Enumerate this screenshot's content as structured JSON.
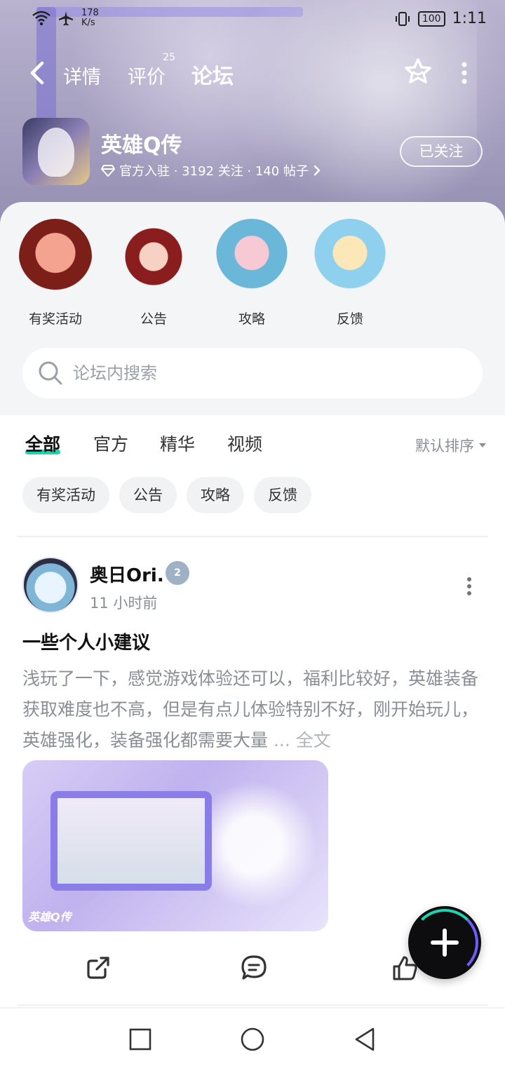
{
  "status": {
    "speed_value": "178",
    "speed_unit": "K/s",
    "battery": "100",
    "time": "1:11"
  },
  "nav": {
    "tabs": [
      {
        "label": "详情"
      },
      {
        "label": "评价",
        "count": "25"
      },
      {
        "label": "论坛"
      }
    ]
  },
  "game": {
    "name": "英雄Q传",
    "meta": "官方入驻 · 3192 关注 · 140 帖子",
    "follow_label": "已关注"
  },
  "categories": [
    {
      "label": "有奖活动"
    },
    {
      "label": "公告"
    },
    {
      "label": "攻略"
    },
    {
      "label": "反馈"
    }
  ],
  "search": {
    "placeholder": "论坛内搜索"
  },
  "feed_tabs": [
    {
      "label": "全部"
    },
    {
      "label": "官方"
    },
    {
      "label": "精华"
    },
    {
      "label": "视频"
    }
  ],
  "sort_label": "默认排序",
  "chips": [
    "有奖活动",
    "公告",
    "攻略",
    "反馈"
  ],
  "post": {
    "username": "奥日Ori.",
    "level": "2",
    "time": "11 小时前",
    "title": "一些个人小建议",
    "body": "浅玩了一下，感觉游戏体验还可以，福利比较好，英雄装备获取难度也不高，但是有点儿体验特别不好，刚开始玩儿，英雄强化，装备强化都需要大量",
    "ellipsis": " ... ",
    "full_text_label": "全文",
    "image_logo": "英雄Q传"
  },
  "colors": {
    "accent": "#1dd3b0",
    "muted_text": "#8a8f95"
  }
}
